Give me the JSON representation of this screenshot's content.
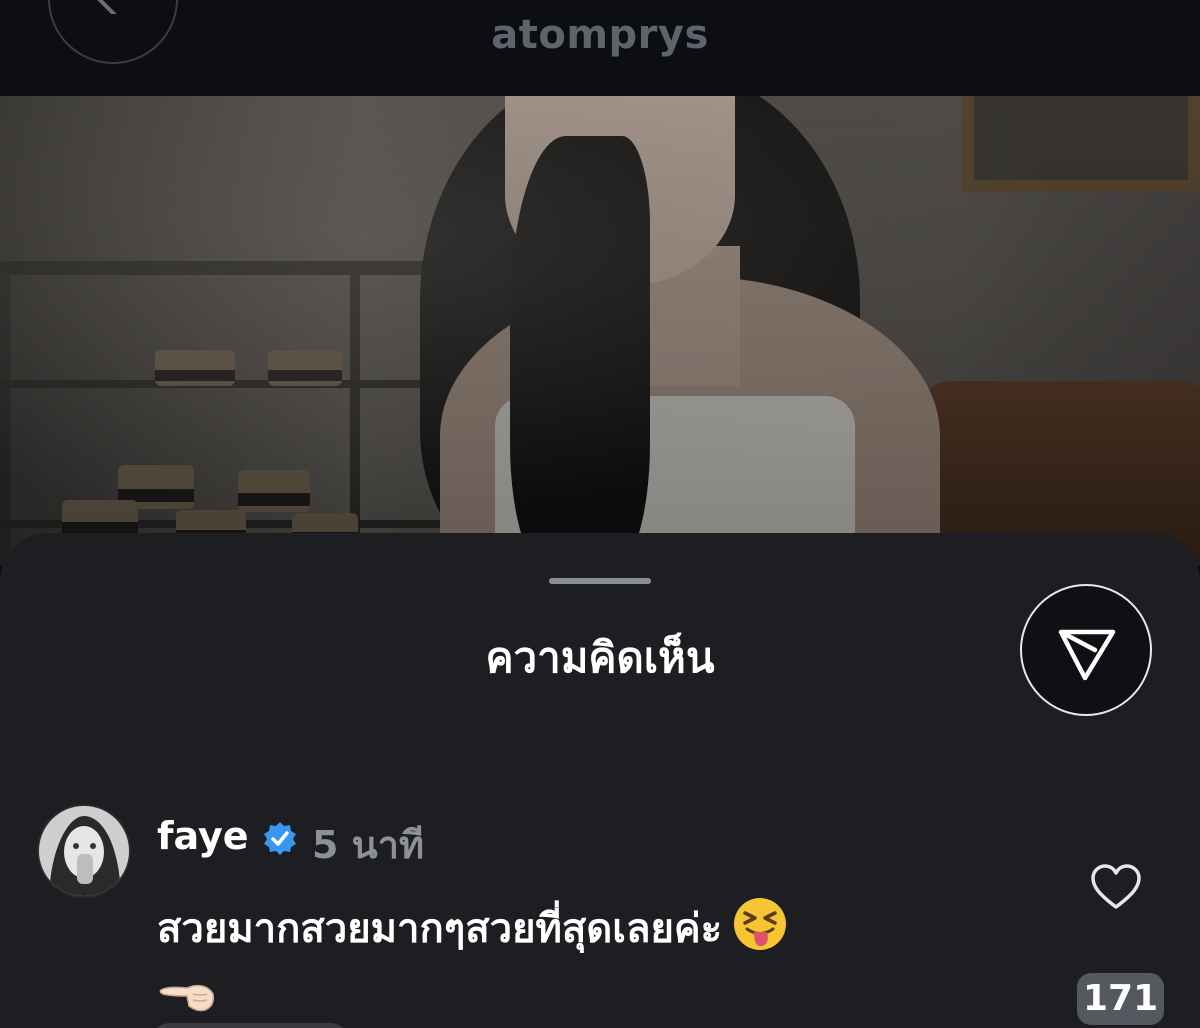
{
  "header": {
    "username": "atomprys"
  },
  "sheet": {
    "title": "ความคิดเห็น"
  },
  "comment": {
    "username": "faye",
    "verified": true,
    "time": "5 นาที",
    "text": "สวยมากสวยมากๆสวยที่สุดเลยค่ะ",
    "emojis": [
      "squinting-face-with-tongue",
      "backhand-index-pointing-left"
    ],
    "likes": "171"
  },
  "colors": {
    "background": "#0c0d10",
    "sheet": "#1c1e22",
    "muted_text": "#8d9097",
    "verified_blue": "#3897f0"
  }
}
